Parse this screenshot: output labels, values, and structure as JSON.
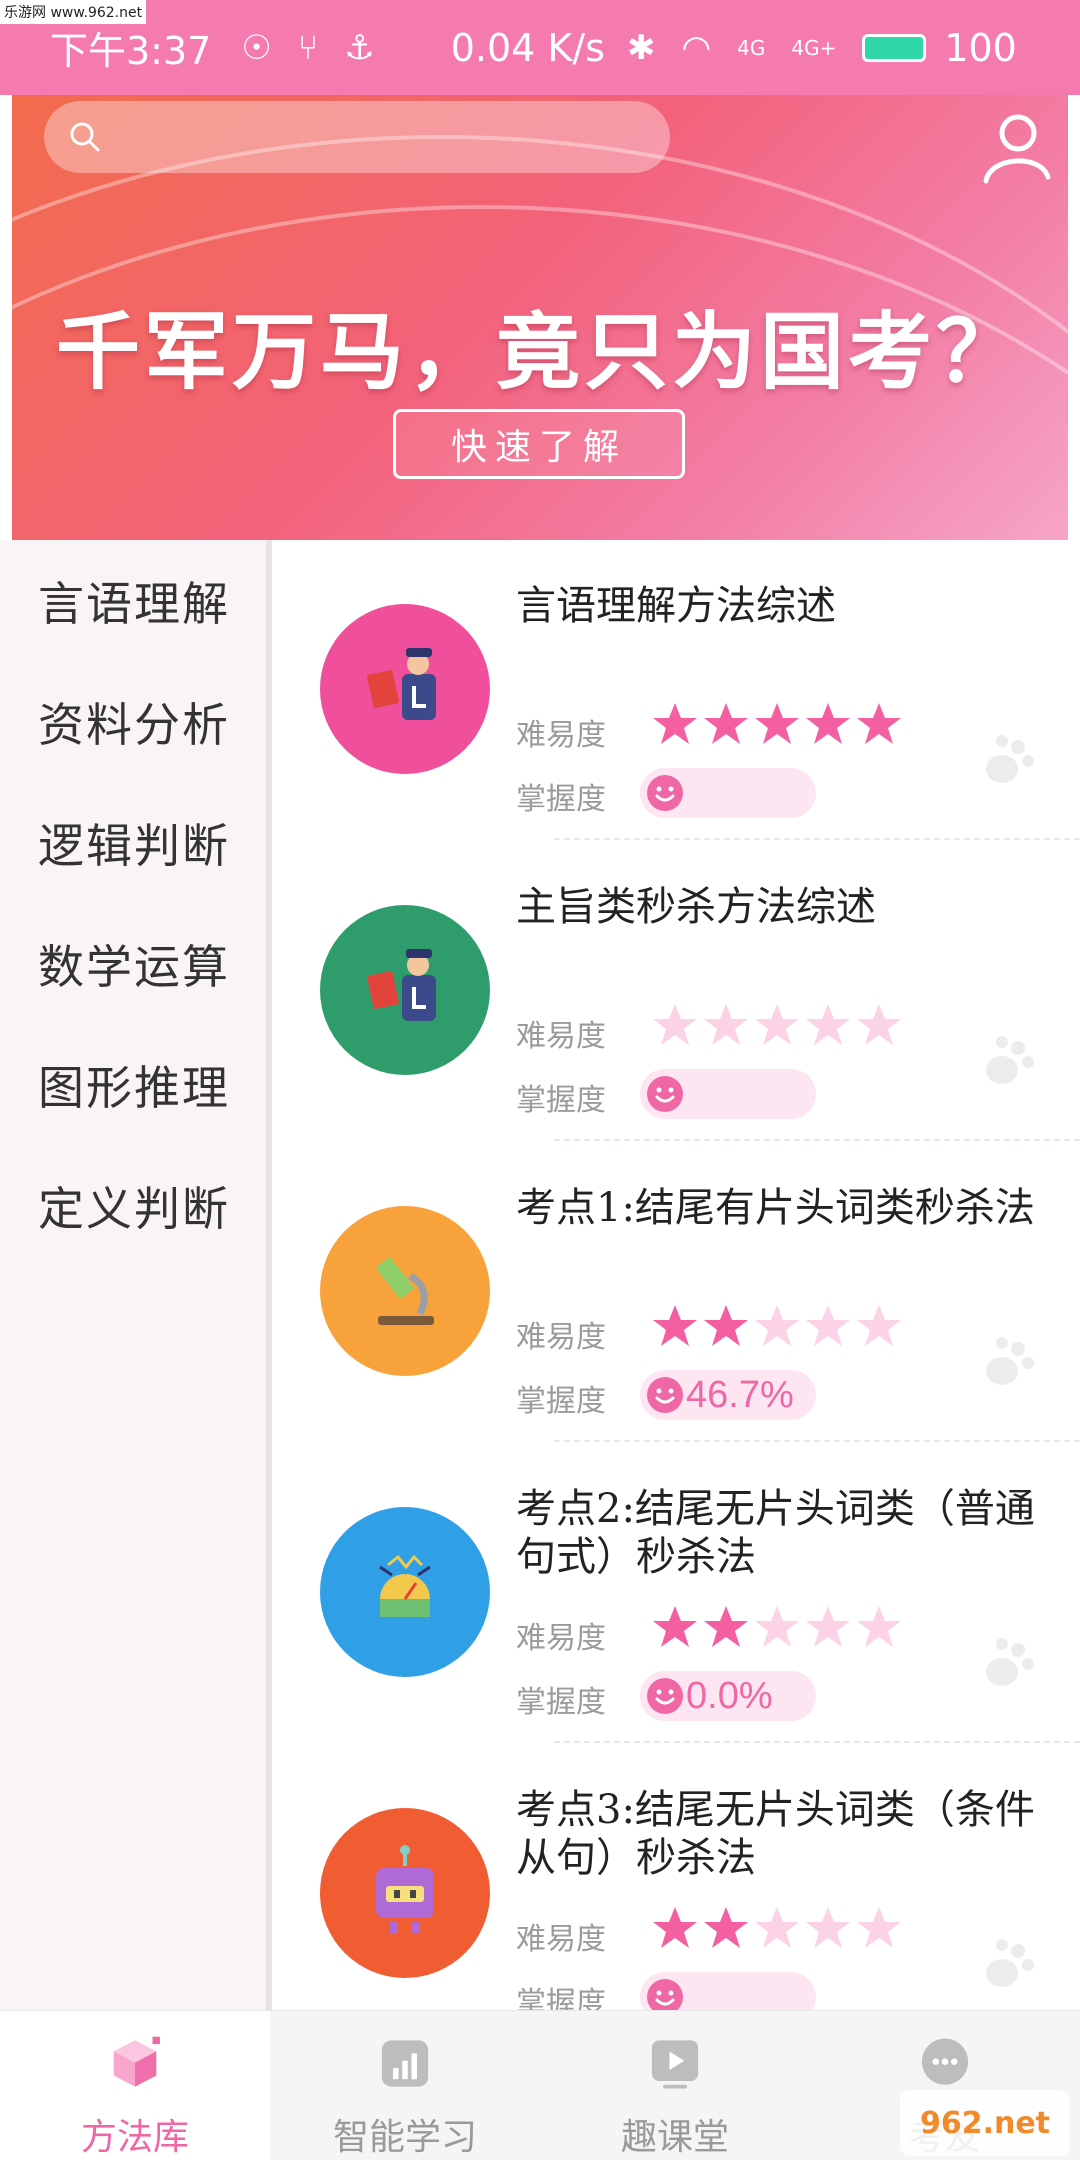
{
  "status_bar": {
    "watermark": "乐游网 www.962.net",
    "time": "下午3:37",
    "speed": "0.04 K/s",
    "signal1": "4G",
    "signal2": "4G+",
    "battery": "100"
  },
  "banner": {
    "search_placeholder": "",
    "slogan": "千军万马，竟只为国考？",
    "button_label": "快速了解"
  },
  "sidebar": {
    "items": [
      {
        "label": "言语理解"
      },
      {
        "label": "资料分析"
      },
      {
        "label": "逻辑判断"
      },
      {
        "label": "数学运算"
      },
      {
        "label": "图形推理"
      },
      {
        "label": "定义判断"
      }
    ]
  },
  "labels": {
    "difficulty": "难易度",
    "mastery": "掌握度"
  },
  "lessons": [
    {
      "title": "言语理解方法综述",
      "difficulty": 5,
      "mastery": "",
      "avatar_color": "#ef4f9b",
      "icon": "reading-officer-icon",
      "faded": false
    },
    {
      "title": "主旨类秒杀方法综述",
      "difficulty": 0,
      "mastery": "",
      "avatar_color": "#2f9c6c",
      "icon": "reading-officer-icon",
      "faded": false
    },
    {
      "title": "考点1:结尾有片头词类秒杀法",
      "difficulty": 2,
      "mastery": "46.7%",
      "avatar_color": "#f7a23b",
      "icon": "microscope-icon",
      "faded": false
    },
    {
      "title": "考点2:结尾无片头词类（普通句式）秒杀法",
      "difficulty": 2,
      "mastery": "0.0%",
      "avatar_color": "#2f9fe6",
      "icon": "meter-device-icon",
      "faded": false
    },
    {
      "title": "考点3:结尾无片头词类（条件从句）秒杀法",
      "difficulty": 2,
      "mastery": "",
      "avatar_color": "#f15d33",
      "icon": "robot-icon",
      "faded": false
    }
  ],
  "colors": {
    "accent": "#f067a6",
    "star_on": "#f45fa2",
    "star_off": "#fcd3e6",
    "status_bar": "#f57ab0"
  },
  "bottom_nav": [
    {
      "label": "方法库",
      "icon": "cube-icon",
      "active": true
    },
    {
      "label": "智能学习",
      "icon": "chart-icon",
      "active": false
    },
    {
      "label": "趣课堂",
      "icon": "video-icon",
      "active": false
    },
    {
      "label": "考友",
      "icon": "chat-icon",
      "active": false
    }
  ],
  "watermark_logo": "962.net"
}
